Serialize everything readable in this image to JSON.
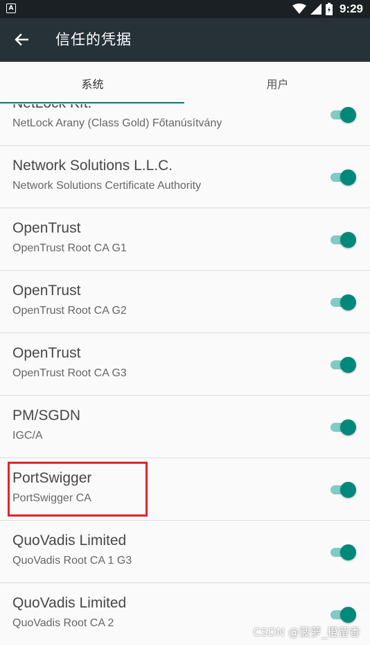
{
  "status_bar": {
    "app_icon_glyph": "A",
    "time": "9:29"
  },
  "app_bar": {
    "title": "信任的凭据",
    "back_icon": "arrow-back-icon"
  },
  "tabs": [
    {
      "label": "系统",
      "selected": true
    },
    {
      "label": "用户",
      "selected": false
    }
  ],
  "colors": {
    "accent": "#00796b",
    "app_bar": "#263238",
    "status_bar": "#1a2023",
    "switch_on": "#00897b",
    "highlight": "#e0232a"
  },
  "certificates": [
    {
      "title": "NetLock Kft.",
      "subtitle": "NetLock Arany (Class Gold) Főtanúsítvány",
      "enabled": true
    },
    {
      "title": "Network Solutions L.L.C.",
      "subtitle": "Network Solutions Certificate Authority",
      "enabled": true
    },
    {
      "title": "OpenTrust",
      "subtitle": "OpenTrust Root CA G1",
      "enabled": true
    },
    {
      "title": "OpenTrust",
      "subtitle": "OpenTrust Root CA G2",
      "enabled": true
    },
    {
      "title": "OpenTrust",
      "subtitle": "OpenTrust Root CA G3",
      "enabled": true
    },
    {
      "title": "PM/SGDN",
      "subtitle": "IGC/A",
      "enabled": true
    },
    {
      "title": "PortSwigger",
      "subtitle": "PortSwigger CA",
      "enabled": true
    },
    {
      "title": "QuoVadis Limited",
      "subtitle": "QuoVadis Root CA 1 G3",
      "enabled": true
    },
    {
      "title": "QuoVadis Limited",
      "subtitle": "QuoVadis Root CA 2",
      "enabled": true
    }
  ],
  "watermark": "CSDN @菠萝_橙留香"
}
